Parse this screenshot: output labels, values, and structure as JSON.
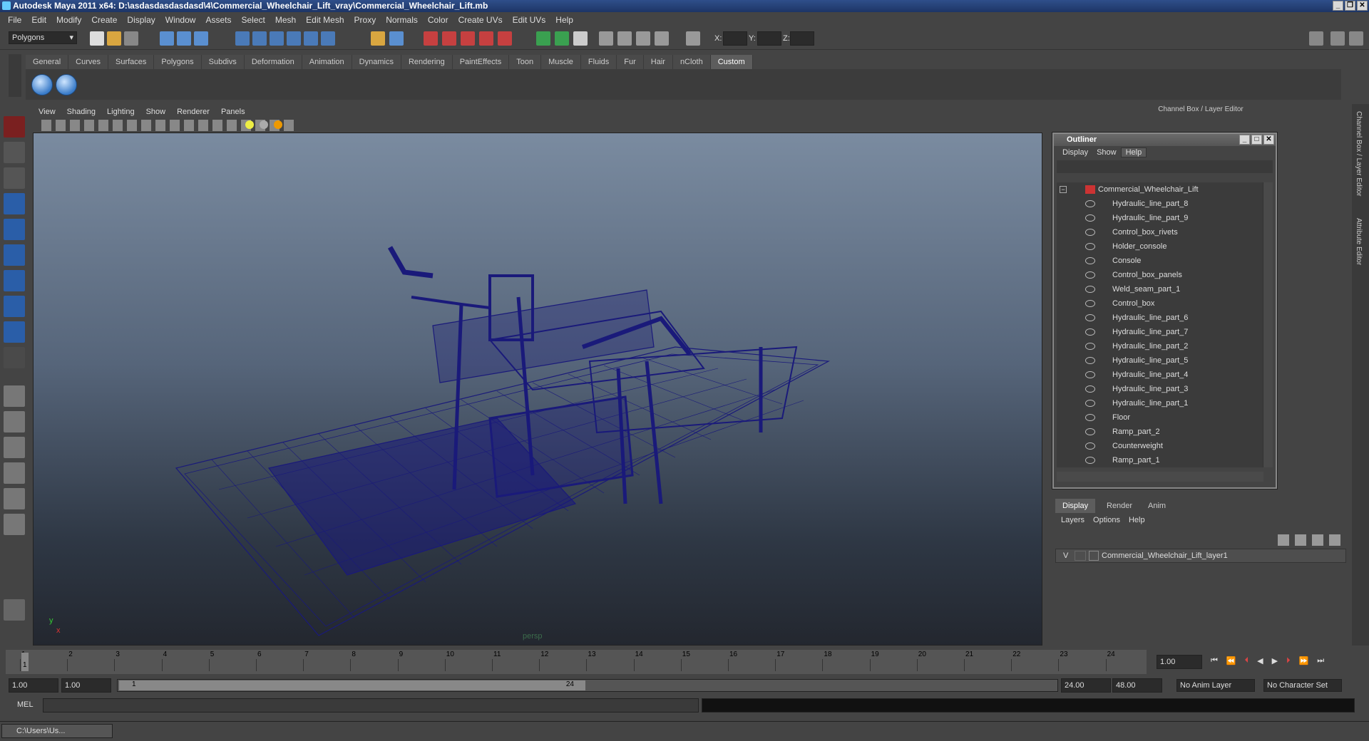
{
  "window": {
    "title": "Autodesk Maya 2011 x64: D:\\asdasdasdasdasd\\4\\Commercial_Wheelchair_Lift_vray\\Commercial_Wheelchair_Lift.mb"
  },
  "menubar": [
    "File",
    "Edit",
    "Modify",
    "Create",
    "Display",
    "Window",
    "Assets",
    "Select",
    "Mesh",
    "Edit Mesh",
    "Proxy",
    "Normals",
    "Color",
    "Create UVs",
    "Edit UVs",
    "Help"
  ],
  "status": {
    "mode": "Polygons",
    "x_label": "X:",
    "y_label": "Y:",
    "z_label": "Z:"
  },
  "shelf_tabs": [
    "General",
    "Curves",
    "Surfaces",
    "Polygons",
    "Subdivs",
    "Deformation",
    "Animation",
    "Dynamics",
    "Rendering",
    "PaintEffects",
    "Toon",
    "Muscle",
    "Fluids",
    "Fur",
    "Hair",
    "nCloth",
    "Custom"
  ],
  "shelf_active": "Custom",
  "viewport": {
    "menu": [
      "View",
      "Shading",
      "Lighting",
      "Show",
      "Renderer",
      "Panels"
    ],
    "camera": "persp"
  },
  "right_panel_title": "Channel Box / Layer Editor",
  "side_tabs": [
    "Channel Box / Layer Editor",
    "Attribute Editor"
  ],
  "outliner": {
    "title": "Outliner",
    "menu": [
      "Display",
      "Show",
      "Help"
    ],
    "root": "Commercial_Wheelchair_Lift",
    "items": [
      "Hydraulic_line_part_8",
      "Hydraulic_line_part_9",
      "Control_box_rivets",
      "Holder_console",
      "Console",
      "Control_box_panels",
      "Weld_seam_part_1",
      "Control_box",
      "Hydraulic_line_part_6",
      "Hydraulic_line_part_7",
      "Hydraulic_line_part_2",
      "Hydraulic_line_part_5",
      "Hydraulic_line_part_4",
      "Hydraulic_line_part_3",
      "Hydraulic_line_part_1",
      "Floor",
      "Ramp_part_2",
      "Counterweight",
      "Ramp_part_1"
    ]
  },
  "layers": {
    "tabs": [
      "Display",
      "Render",
      "Anim"
    ],
    "menu": [
      "Layers",
      "Options",
      "Help"
    ],
    "v": "V",
    "layer_name": "Commercial_Wheelchair_Lift_layer1"
  },
  "timeline": {
    "ticks": [
      "1",
      "2",
      "3",
      "4",
      "5",
      "6",
      "7",
      "8",
      "9",
      "10",
      "11",
      "12",
      "13",
      "14",
      "15",
      "16",
      "17",
      "18",
      "19",
      "20",
      "21",
      "22",
      "23",
      "24"
    ],
    "current_field": "1.00",
    "current_marker": "1"
  },
  "range": {
    "start": "1.00",
    "start2": "1.00",
    "slider_start": "1",
    "slider_end": "24",
    "end": "24.00",
    "end2": "48.00",
    "anim_layer": "No Anim Layer",
    "char_set": "No Character Set"
  },
  "cmdline": {
    "label": "MEL"
  },
  "taskbar": {
    "item": "C:\\Users\\Us..."
  },
  "colors": {
    "wire": "#1a1a7a",
    "accent": "#3a7cc9"
  }
}
